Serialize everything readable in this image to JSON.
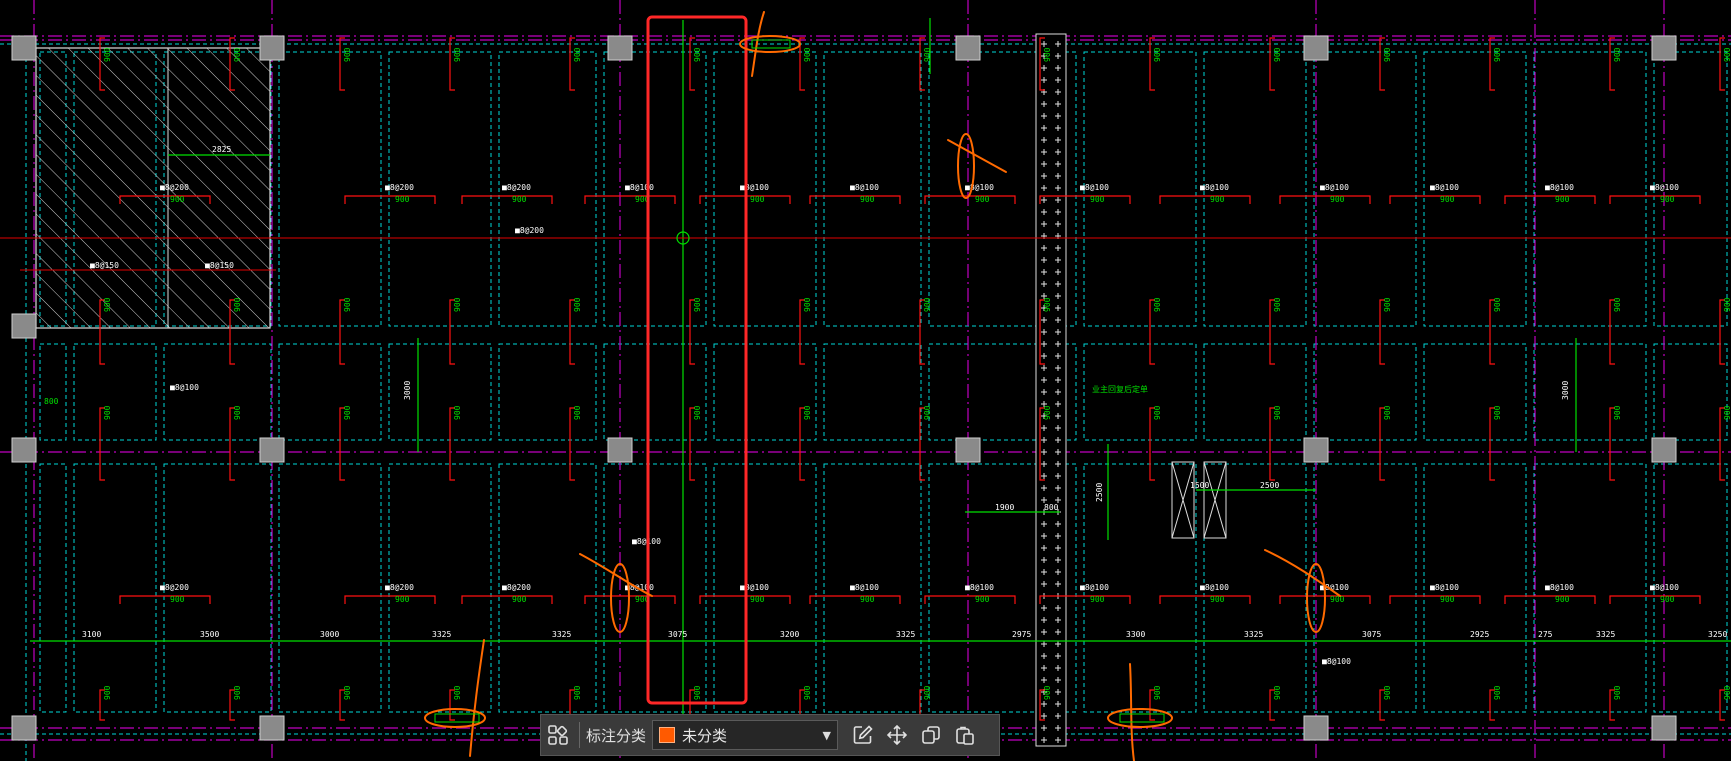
{
  "window": {
    "width": 1731,
    "height": 761
  },
  "colors": {
    "background": "#000000",
    "column_fill": "#8a8a8a",
    "axis_line": "#cc00cc",
    "beam_line": "#00ffff",
    "dim_line": "#00ff00",
    "rebar_mark": "#ff0000",
    "highlight_box": "#ff2020",
    "markup_stroke": "#ff6a00",
    "toolbar_bg": "#3a3a3a",
    "category_swatch": "#ff5a00"
  },
  "drawing": {
    "top_labels": [
      "900",
      "900",
      "900",
      "900",
      "900",
      "900",
      "900",
      "900",
      "900",
      "900",
      "900",
      "900",
      "900",
      "900",
      "900",
      "900"
    ],
    "rebar_labels": [
      "■8@200",
      "■8@200",
      "■8@200",
      "■8@100",
      "■8@100",
      "■8@100",
      "■8@100",
      "■8@100",
      "■8@100",
      "■8@100",
      "■8@100",
      "■8@100",
      "■8@100",
      "■8@100",
      "■8@100"
    ],
    "rebar_values": [
      "900",
      "900",
      "900",
      "900",
      "900",
      "900",
      "900",
      "900",
      "900",
      "900",
      "900",
      "900",
      "900",
      "900",
      "900"
    ],
    "bottom_dims": [
      "3100",
      "3500",
      "3000",
      "3325",
      "3325",
      "3075",
      "3200",
      "3325",
      "2975",
      "3300",
      "3325",
      "3075",
      "2925",
      "275",
      "3325",
      "3250"
    ],
    "misc": {
      "dim_2825": "2825",
      "rebar_center": "■8@200",
      "hatched_label_1": "■8@150",
      "hatched_label_2": "■8@150",
      "dim_3000_left": "3000",
      "dim_3000_right": "3000",
      "dim_1900": "1900",
      "dim_800": "800",
      "dim_2500_v": "2500",
      "dim_1500": "1500",
      "dim_2500_h": "2500",
      "left_800": "800",
      "note_green": "业主回复后定单",
      "mid_rebar_1": "■8@100",
      "mid_rebar_2": "■8@100",
      "mid_rebar_3": "■8@100"
    }
  },
  "toolbar": {
    "label": "标注分类",
    "category_value": "未分类",
    "category_options": [
      "未分类"
    ],
    "icons": [
      "grid-icon",
      "edit-icon",
      "move-icon",
      "copy-icon",
      "paste-icon"
    ]
  }
}
